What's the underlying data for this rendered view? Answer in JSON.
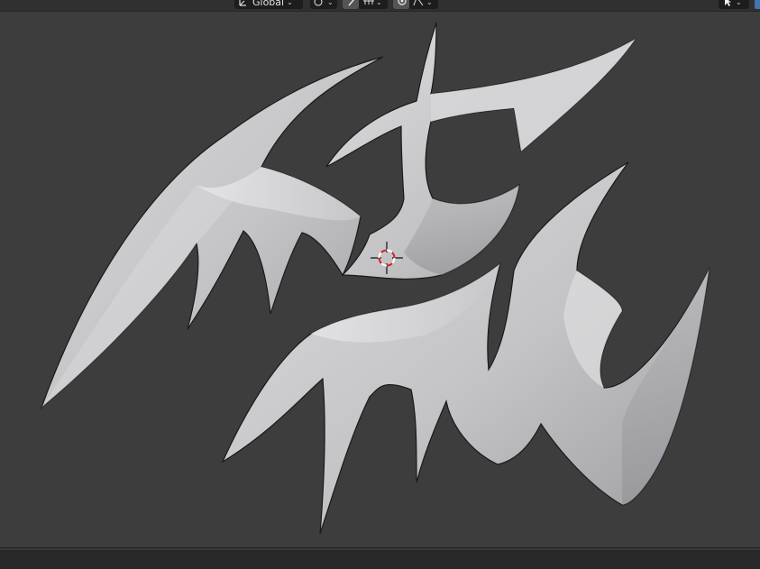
{
  "header": {
    "orientation_label": "Global",
    "icons": {
      "orientation": "transform-orientation-icon",
      "pivot": "pivot-point-icon",
      "snap": "snap-icon",
      "snap_target": "snap-increment-icon",
      "proportional": "proportional-editing-icon",
      "falloff": "falloff-curve-icon",
      "select": "select-cursor-icon",
      "gizmo": "gizmo-icon"
    }
  },
  "viewport": {
    "background": "#3d3d3d",
    "object_color": "#c9c9cb",
    "cursor_icon": "3d-cursor-icon"
  },
  "statusbar": {
    "background": "#282828"
  }
}
